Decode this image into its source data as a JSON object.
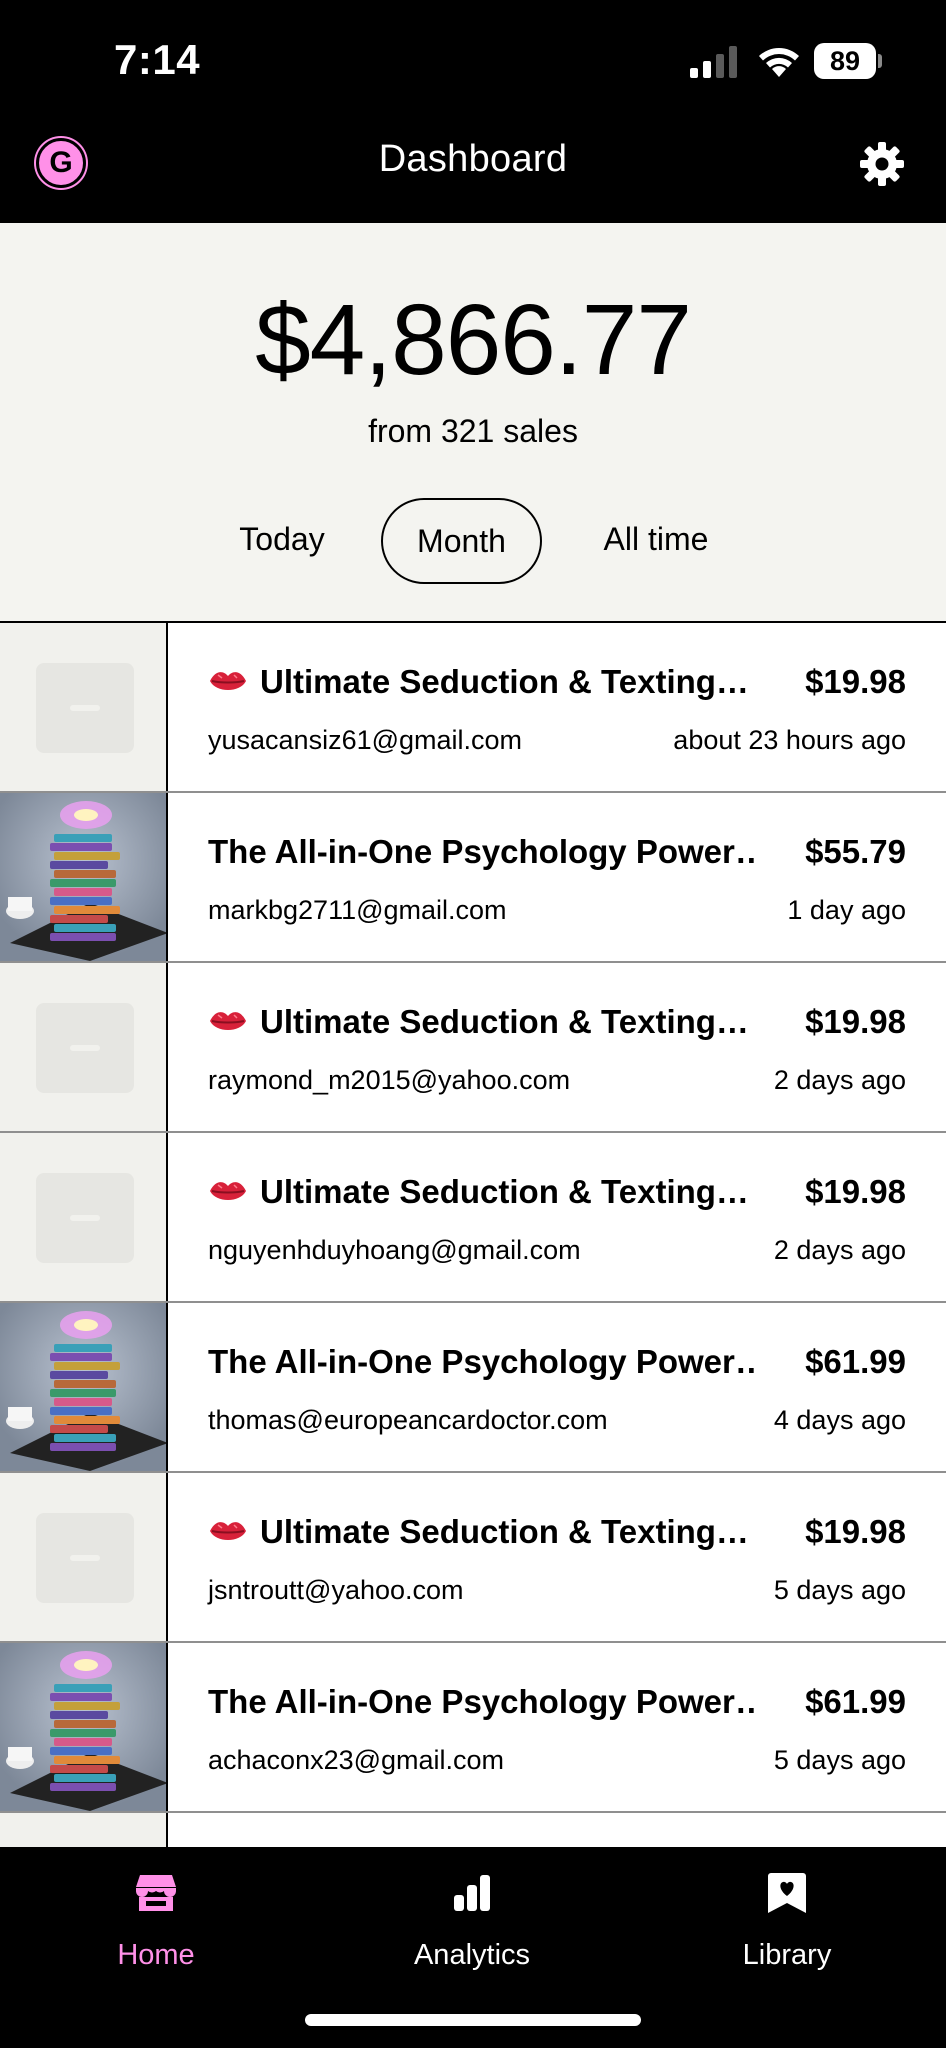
{
  "status_bar": {
    "time": "7:14",
    "battery": "89"
  },
  "header": {
    "avatar_letter": "G",
    "title": "Dashboard"
  },
  "summary": {
    "amount": "$4,866.77",
    "sales_count": "from 321 sales",
    "periods": [
      "Today",
      "Month",
      "All time"
    ],
    "selected_period": "Month"
  },
  "sales": [
    {
      "emoji": "💋",
      "title": "Ultimate Seduction & Texting…",
      "price": "$19.98",
      "email": "yusacansiz61@gmail.com",
      "time": "about 23 hours ago",
      "thumbnail": "placeholder"
    },
    {
      "emoji": "",
      "title": "The All-in-One Psychology Power…",
      "price": "$55.79",
      "email": "markbg2711@gmail.com",
      "time": "1 day ago",
      "thumbnail": "books-stack"
    },
    {
      "emoji": "💋",
      "title": "Ultimate Seduction & Texting…",
      "price": "$19.98",
      "email": "raymond_m2015@yahoo.com",
      "time": "2 days ago",
      "thumbnail": "placeholder"
    },
    {
      "emoji": "💋",
      "title": "Ultimate Seduction & Texting…",
      "price": "$19.98",
      "email": "nguyenhduyhoang@gmail.com",
      "time": "2 days ago",
      "thumbnail": "placeholder"
    },
    {
      "emoji": "",
      "title": "The All-in-One Psychology Power…",
      "price": "$61.99",
      "email": "thomas@europeancardoctor.com",
      "time": "4 days ago",
      "thumbnail": "books-stack"
    },
    {
      "emoji": "💋",
      "title": "Ultimate Seduction & Texting…",
      "price": "$19.98",
      "email": "jsntroutt@yahoo.com",
      "time": "5 days ago",
      "thumbnail": "placeholder"
    },
    {
      "emoji": "",
      "title": "The All-in-One Psychology Power…",
      "price": "$61.99",
      "email": "achaconx23@gmail.com",
      "time": "5 days ago",
      "thumbnail": "books-stack"
    }
  ],
  "tabs": [
    {
      "label": "Home",
      "icon": "store-icon",
      "active": true
    },
    {
      "label": "Analytics",
      "icon": "bar-chart-icon",
      "active": false
    },
    {
      "label": "Library",
      "icon": "bookmark-icon",
      "active": false
    }
  ],
  "colors": {
    "accent_pink": "#ff90e8",
    "summary_bg": "#f4f4f0",
    "bar_bg": "#000000"
  }
}
